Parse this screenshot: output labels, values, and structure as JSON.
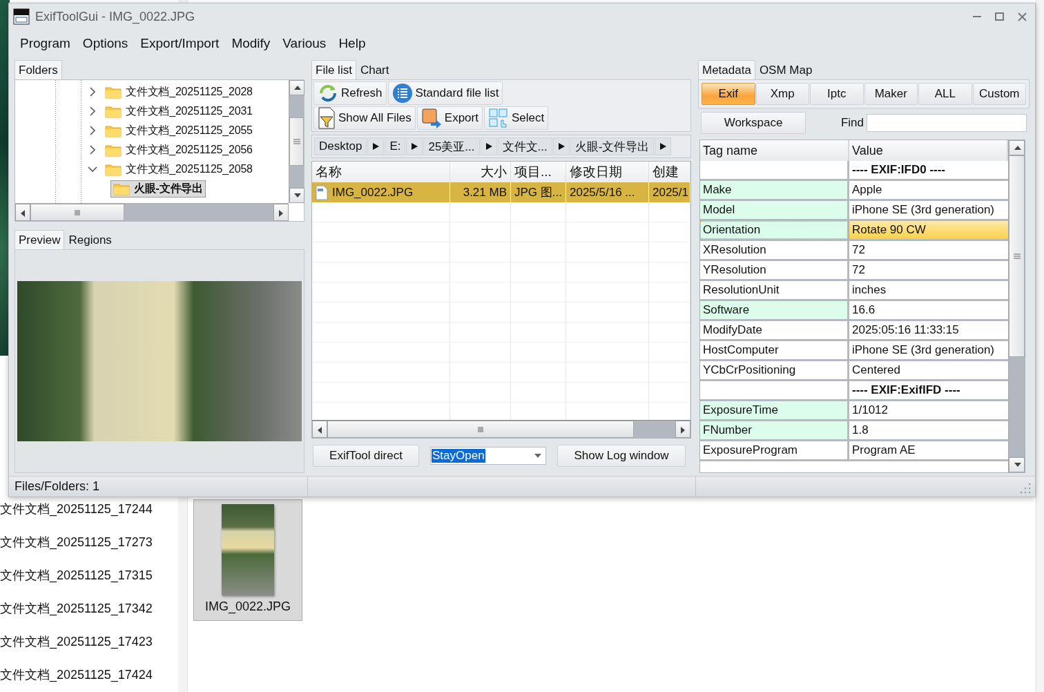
{
  "window": {
    "title": "ExifToolGui - IMG_0022.JPG"
  },
  "menu": [
    "Program",
    "Options",
    "Export/Import",
    "Modify",
    "Various",
    "Help"
  ],
  "folders": {
    "tabs": [
      {
        "label": "Folders",
        "selected": true
      }
    ],
    "tree": [
      {
        "label": "文件文档_20251125_2028",
        "expanded": false,
        "selected": false
      },
      {
        "label": "文件文档_20251125_2031",
        "expanded": false,
        "selected": false
      },
      {
        "label": "文件文档_20251125_2055",
        "expanded": false,
        "selected": false
      },
      {
        "label": "文件文档_20251125_2056",
        "expanded": false,
        "selected": false
      },
      {
        "label": "文件文档_20251125_2058",
        "expanded": true,
        "selected": false,
        "children": [
          {
            "label": "火眼-文件导出",
            "selected": true
          }
        ]
      }
    ]
  },
  "preview": {
    "tabs": [
      {
        "label": "Preview",
        "selected": true
      },
      {
        "label": "Regions",
        "selected": false
      }
    ]
  },
  "file_list": {
    "tabs": [
      {
        "label": "File list",
        "selected": true
      },
      {
        "label": "Chart",
        "selected": false
      }
    ],
    "toolbar": [
      [
        {
          "label": "Refresh",
          "kind": "refresh"
        },
        {
          "label": "Standard file list",
          "kind": "list"
        }
      ],
      [
        {
          "label": "Show All Files",
          "kind": "filter"
        },
        {
          "label": "Export",
          "kind": "export"
        },
        {
          "label": "Select",
          "kind": "select"
        }
      ]
    ],
    "breadcrumb": [
      "Desktop",
      "E:",
      "25美亚...",
      "文件文...",
      "火眼-文件导出"
    ],
    "columns": [
      "名称",
      "大小",
      "项目...",
      "修改日期",
      "创建"
    ],
    "rows": [
      {
        "cells": [
          "IMG_0022.JPG",
          "3.21 MB",
          "JPG 图...",
          "2025/5/16 ...",
          "2025/1"
        ],
        "selected": true
      }
    ],
    "exiftool_button": "ExifTool direct",
    "mode": {
      "value": "StayOpen"
    },
    "log_button": "Show Log window"
  },
  "metadata": {
    "tabs": [
      {
        "label": "Metadata",
        "selected": true
      },
      {
        "label": "OSM Map",
        "selected": false
      }
    ],
    "views": [
      {
        "label": "Exif",
        "selected": true
      },
      {
        "label": "Xmp",
        "selected": false
      },
      {
        "label": "Iptc",
        "selected": false
      },
      {
        "label": "Maker",
        "selected": false
      },
      {
        "label": "ALL",
        "selected": false
      },
      {
        "label": "Custom",
        "selected": false
      }
    ],
    "workspace_button": "Workspace",
    "find": {
      "label": "Find"
    },
    "columns": [
      "Tag name",
      "Value"
    ],
    "rows": [
      {
        "kind": "group",
        "value": "---- EXIF:IFD0 ----"
      },
      {
        "kind": "tag",
        "tag": "Make",
        "value": "Apple",
        "highlighted": true,
        "selected": false
      },
      {
        "kind": "tag",
        "tag": "Model",
        "value": "iPhone SE (3rd generation)",
        "highlighted": true,
        "selected": false
      },
      {
        "kind": "tag",
        "tag": "Orientation",
        "value": "Rotate 90 CW",
        "highlighted": true,
        "selected": true
      },
      {
        "kind": "tag",
        "tag": "XResolution",
        "value": "72",
        "highlighted": false,
        "selected": false
      },
      {
        "kind": "tag",
        "tag": "YResolution",
        "value": "72",
        "highlighted": false,
        "selected": false
      },
      {
        "kind": "tag",
        "tag": "ResolutionUnit",
        "value": "inches",
        "highlighted": false,
        "selected": false
      },
      {
        "kind": "tag",
        "tag": "Software",
        "value": "16.6",
        "highlighted": true,
        "selected": false
      },
      {
        "kind": "tag",
        "tag": "ModifyDate",
        "value": "2025:05:16 11:33:15",
        "highlighted": false,
        "selected": false
      },
      {
        "kind": "tag",
        "tag": "HostComputer",
        "value": "iPhone SE (3rd generation)",
        "highlighted": false,
        "selected": false
      },
      {
        "kind": "tag",
        "tag": "YCbCrPositioning",
        "value": "Centered",
        "highlighted": false,
        "selected": false
      },
      {
        "kind": "group",
        "value": "---- EXIF:ExifIFD ----"
      },
      {
        "kind": "tag",
        "tag": "ExposureTime",
        "value": "1/1012",
        "highlighted": true,
        "selected": false
      },
      {
        "kind": "tag",
        "tag": "FNumber",
        "value": "1.8",
        "highlighted": true,
        "selected": false
      },
      {
        "kind": "tag",
        "tag": "ExposureProgram",
        "value": "Program AE",
        "highlighted": false,
        "selected": false
      }
    ]
  },
  "status_bar": {
    "text": "Files/Folders: 1"
  },
  "desktop": {
    "explorer_items": [
      "文件文档_20251125_17244",
      "文件文档_20251125_17273",
      "文件文档_20251125_17315",
      "文件文档_20251125_17342",
      "文件文档_20251125_17423",
      "文件文档_20251125_17424"
    ],
    "thumbnail": {
      "label": "IMG_0022.JPG"
    }
  }
}
